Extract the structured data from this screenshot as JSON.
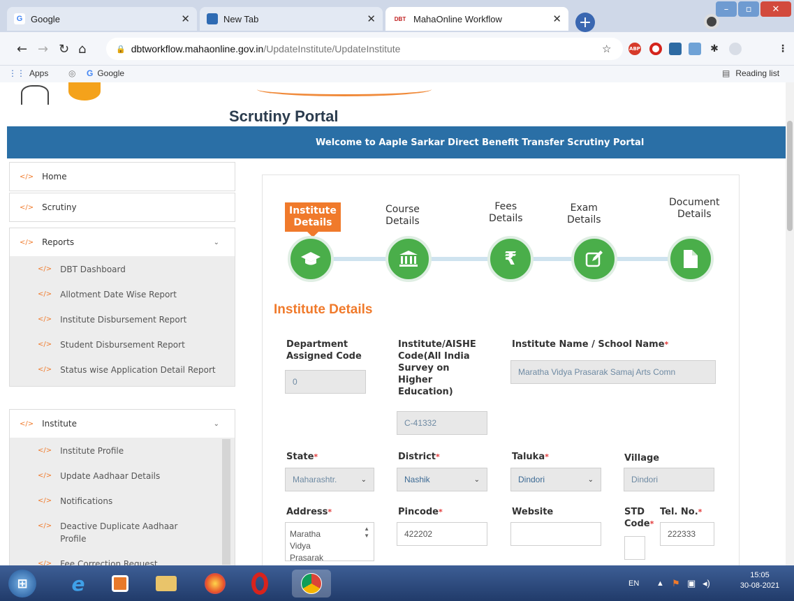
{
  "browser": {
    "tabs": [
      {
        "title": "Google",
        "favicon": "G"
      },
      {
        "title": "New Tab",
        "favicon": "new-tab"
      },
      {
        "title": "MahaOnline Workflow",
        "favicon": "DBT"
      }
    ],
    "url_host": "dbtworkflow.mahaonline.gov.in",
    "url_path": "/UpdateInstitute/UpdateInstitute",
    "bookmarks": {
      "apps": "Apps",
      "google": "Google",
      "reading_list": "Reading list"
    }
  },
  "portal": {
    "title": "Scrutiny Portal",
    "banner": "Welcome to Aaple Sarkar Direct Benefit Transfer Scrutiny Portal"
  },
  "sidebar": {
    "home": "Home",
    "scrutiny": "Scrutiny",
    "reports": {
      "label": "Reports",
      "items": [
        "DBT Dashboard",
        "Allotment Date Wise Report",
        "Institute Disbursement Report",
        "Student Disbursement Report",
        "Status wise Application Detail Report"
      ]
    },
    "institute": {
      "label": "Institute",
      "items": [
        "Institute Profile",
        "Update Aadhaar Details",
        "Notifications",
        "Deactive Duplicate Aadhaar Profile",
        "Fee Correction Request"
      ]
    }
  },
  "wizard": {
    "steps": [
      {
        "label1": "Institute",
        "label2": "Details",
        "icon": "graduation-cap-icon"
      },
      {
        "label1": "Course",
        "label2": "Details",
        "icon": "institution-icon"
      },
      {
        "label1": "Fees",
        "label2": "Details",
        "icon": "rupee-icon"
      },
      {
        "label1": "Exam",
        "label2": "Details",
        "icon": "edit-icon"
      },
      {
        "label1": "Document",
        "label2": "Details",
        "icon": "document-icon"
      }
    ],
    "active_step": 0,
    "rupee_symbol": "₹",
    "section_title": "Institute Details"
  },
  "form": {
    "dept_code": {
      "label1": "Department",
      "label2": "Assigned Code",
      "value": "0"
    },
    "aishe": {
      "label1": "Institute/AISHE",
      "label2": "Code(All India",
      "label3": "Survey on",
      "label4": "Higher",
      "label5": "Education)",
      "value": "C-41332"
    },
    "inst_name": {
      "label": "Institute Name / School Name",
      "value": "Maratha Vidya Prasarak Samaj Arts Comn"
    },
    "state": {
      "label": "State",
      "value": "Maharashtr."
    },
    "district": {
      "label": "District",
      "value": "Nashik"
    },
    "taluka": {
      "label": "Taluka",
      "value": "Dindori"
    },
    "village": {
      "label": "Village",
      "value": "Dindori"
    },
    "address": {
      "label": "Address",
      "line1": "Maratha",
      "line2": "Vidya",
      "line3": "Prasarak"
    },
    "pincode": {
      "label": "Pincode",
      "value": "422202"
    },
    "website": {
      "label": "Website",
      "value": ""
    },
    "std": {
      "label1": "STD",
      "label2": "Code",
      "value": ""
    },
    "tel": {
      "label": "Tel. No.",
      "value": "222333"
    },
    "required_mark": "*"
  },
  "taskbar": {
    "lang": "EN",
    "time": "15:05",
    "date": "30-08-2021"
  },
  "colors": {
    "accent": "#f07a2b",
    "banner": "#2a6fa6",
    "step_green": "#4aae4a"
  }
}
